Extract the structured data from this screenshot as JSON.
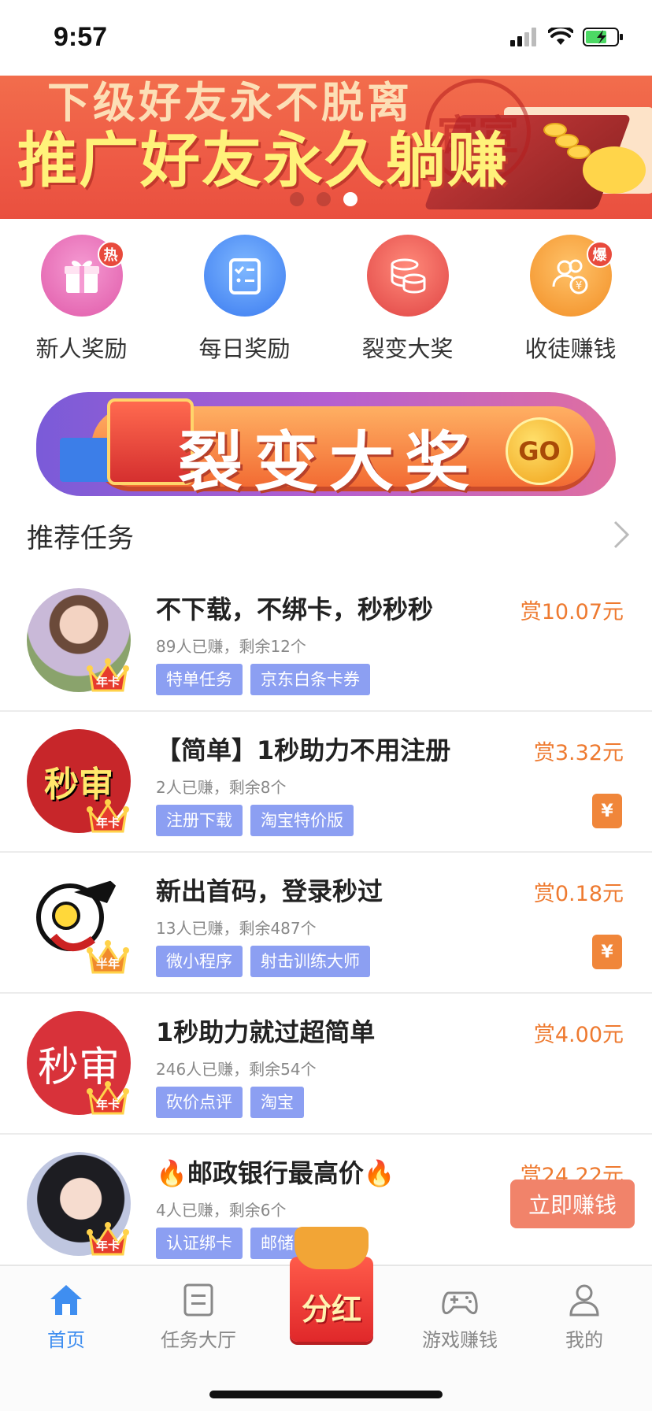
{
  "status_bar": {
    "time": "9:57"
  },
  "banner": {
    "headline_top": "下级好友永不脱离",
    "headline": "推广好友永久躺赚",
    "seal_text": "官宣",
    "page_count": 3,
    "active_index": 2
  },
  "quick_entries": [
    {
      "label": "新人奖励",
      "icon": "gift-icon",
      "badge": "热",
      "color": "#e05aa9"
    },
    {
      "label": "每日奖励",
      "icon": "checklist-icon",
      "badge": "",
      "color": "#3a7af0"
    },
    {
      "label": "裂变大奖",
      "icon": "coins-stack-icon",
      "badge": "",
      "color": "#e04444"
    },
    {
      "label": "收徒赚钱",
      "icon": "people-coin-icon",
      "badge": "爆",
      "color": "#f28e25"
    }
  ],
  "promo": {
    "text": "裂变大奖",
    "go": "GO"
  },
  "section": {
    "title": "推荐任务"
  },
  "tasks": [
    {
      "title": "不下载，不绑卡，秒秒秒",
      "meta": "89人已赚，剩余12个",
      "tags": [
        "特单任务",
        "京东白条卡券"
      ],
      "reward": "赏10.07元",
      "crown": "年卡",
      "avatar_text": "",
      "redpacket": false
    },
    {
      "title": "【简单】1秒助力不用注册",
      "meta": "2人已赚，剩余8个",
      "tags": [
        "注册下载",
        "淘宝特价版"
      ],
      "reward": "赏3.32元",
      "crown": "年卡",
      "avatar_text": "秒审",
      "redpacket": true
    },
    {
      "title": "新出首码，登录秒过",
      "meta": "13人已赚，剩余487个",
      "tags": [
        "微小程序",
        "射击训练大师"
      ],
      "reward": "赏0.18元",
      "crown": "半年",
      "avatar_text": "",
      "redpacket": true
    },
    {
      "title": "1秒助力就过超简单",
      "meta": "246人已赚，剩余54个",
      "tags": [
        "砍价点评",
        "淘宝"
      ],
      "reward": "赏4.00元",
      "crown": "年卡",
      "avatar_text": "秒审",
      "redpacket": false
    },
    {
      "title": "🔥邮政银行最高价🔥",
      "meta": "4人已赚，剩余6个",
      "tags": [
        "认证绑卡",
        "邮储银行"
      ],
      "reward": "赏24.22元",
      "crown": "年卡",
      "avatar_text": "",
      "redpacket": false
    }
  ],
  "earn_button": "立即赚钱",
  "redpacket_symbol": "¥",
  "tab_bar": {
    "tabs": [
      {
        "label": "首页",
        "icon": "home-icon",
        "active": true
      },
      {
        "label": "任务大厅",
        "icon": "task-list-icon",
        "active": false
      },
      {
        "label": "分红",
        "icon": "red-envelope-icon",
        "active": false
      },
      {
        "label": "游戏赚钱",
        "icon": "gamepad-icon",
        "active": false
      },
      {
        "label": "我的",
        "icon": "user-icon",
        "active": false
      }
    ]
  }
}
